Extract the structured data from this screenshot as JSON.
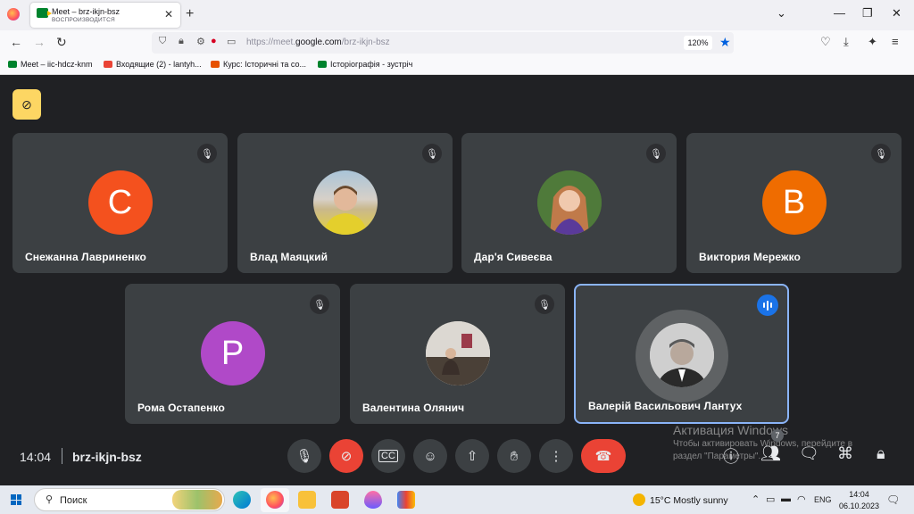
{
  "browser": {
    "tab_title": "Meet – brz-ikjn-bsz",
    "tab_subtitle": "ВОСПРОИЗВОДИТСЯ",
    "url_prefix": "https://meet.",
    "url_domain": "google.com",
    "url_path": "/brz-ikjn-bsz",
    "zoom": "120%",
    "bookmarks": [
      {
        "label": "Meet – iic-hdcz-knm",
        "color": "#00832d"
      },
      {
        "label": "Входящие (2) - lantyh...",
        "color": "#ea4335"
      },
      {
        "label": "Курс: Історичні та со...",
        "color": "#e65100"
      },
      {
        "label": "Історіографія - зустріч",
        "color": "#00832d"
      }
    ]
  },
  "meet": {
    "participants": [
      {
        "name": "Снежанна Лавриненко",
        "initial": "С",
        "color": "#f4511e",
        "muted": true
      },
      {
        "name": "Влад Маяцкий",
        "initial": "",
        "muted": true
      },
      {
        "name": "Дар'я Сивеєва",
        "initial": "",
        "muted": true
      },
      {
        "name": "Виктория Мережко",
        "initial": "В",
        "color": "#ef6c00",
        "muted": true
      },
      {
        "name": "Рома Остапенко",
        "initial": "P",
        "color": "#b049c8",
        "muted": true
      },
      {
        "name": "Валентина Олянич",
        "initial": "",
        "muted": true
      },
      {
        "name": "Валерій Васильович Лантух",
        "initial": "",
        "muted": false,
        "speaking": true
      }
    ],
    "time": "14:04",
    "meeting_code": "brz-ikjn-bsz",
    "people_count": "7",
    "watermark_title": "Активация Windows",
    "watermark_line1": "Чтобы активировать Windows, перейдите в",
    "watermark_line2": "раздел \"Параметры\"."
  },
  "taskbar": {
    "search_placeholder": "Поиск",
    "weather": "15°C  Mostly sunny",
    "lang": "ENG",
    "clock_time": "14:04",
    "clock_date": "06.10.2023"
  }
}
